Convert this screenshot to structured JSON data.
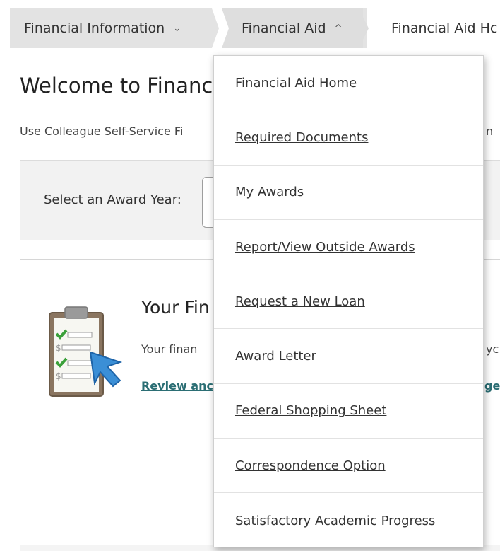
{
  "breadcrumb": {
    "items": [
      {
        "label": "Financial Information",
        "icon": "chevron-down-icon",
        "chevron": "⌄"
      },
      {
        "label": "Financial Aid",
        "icon": "chevron-up-icon",
        "chevron": "^"
      },
      {
        "label": "Financial Aid Hc"
      }
    ]
  },
  "main": {
    "welcome_title": "Welcome to Financ",
    "intro_text": "Use Colleague Self-Service Fi",
    "intro_tail": "n",
    "award_year_label": "Select an Award Year:",
    "info_card": {
      "title": "Your Fin",
      "text": "Your finan",
      "text_tail": "yc",
      "link": "Review anc",
      "link_tail": "ge"
    }
  },
  "dropdown": {
    "items": [
      "Financial Aid Home",
      "Required Documents",
      "My Awards",
      "Report/View Outside Awards",
      "Request a New Loan",
      "Award Letter",
      "Federal Shopping Sheet",
      "Correspondence Option",
      "Satisfactory Academic Progress"
    ]
  },
  "colors": {
    "link": "#2b6e74",
    "breadcrumb_bg": "#e3e3e3",
    "checkmark": "#3aa03a",
    "cursor_arrow": "#3b8fd6"
  }
}
